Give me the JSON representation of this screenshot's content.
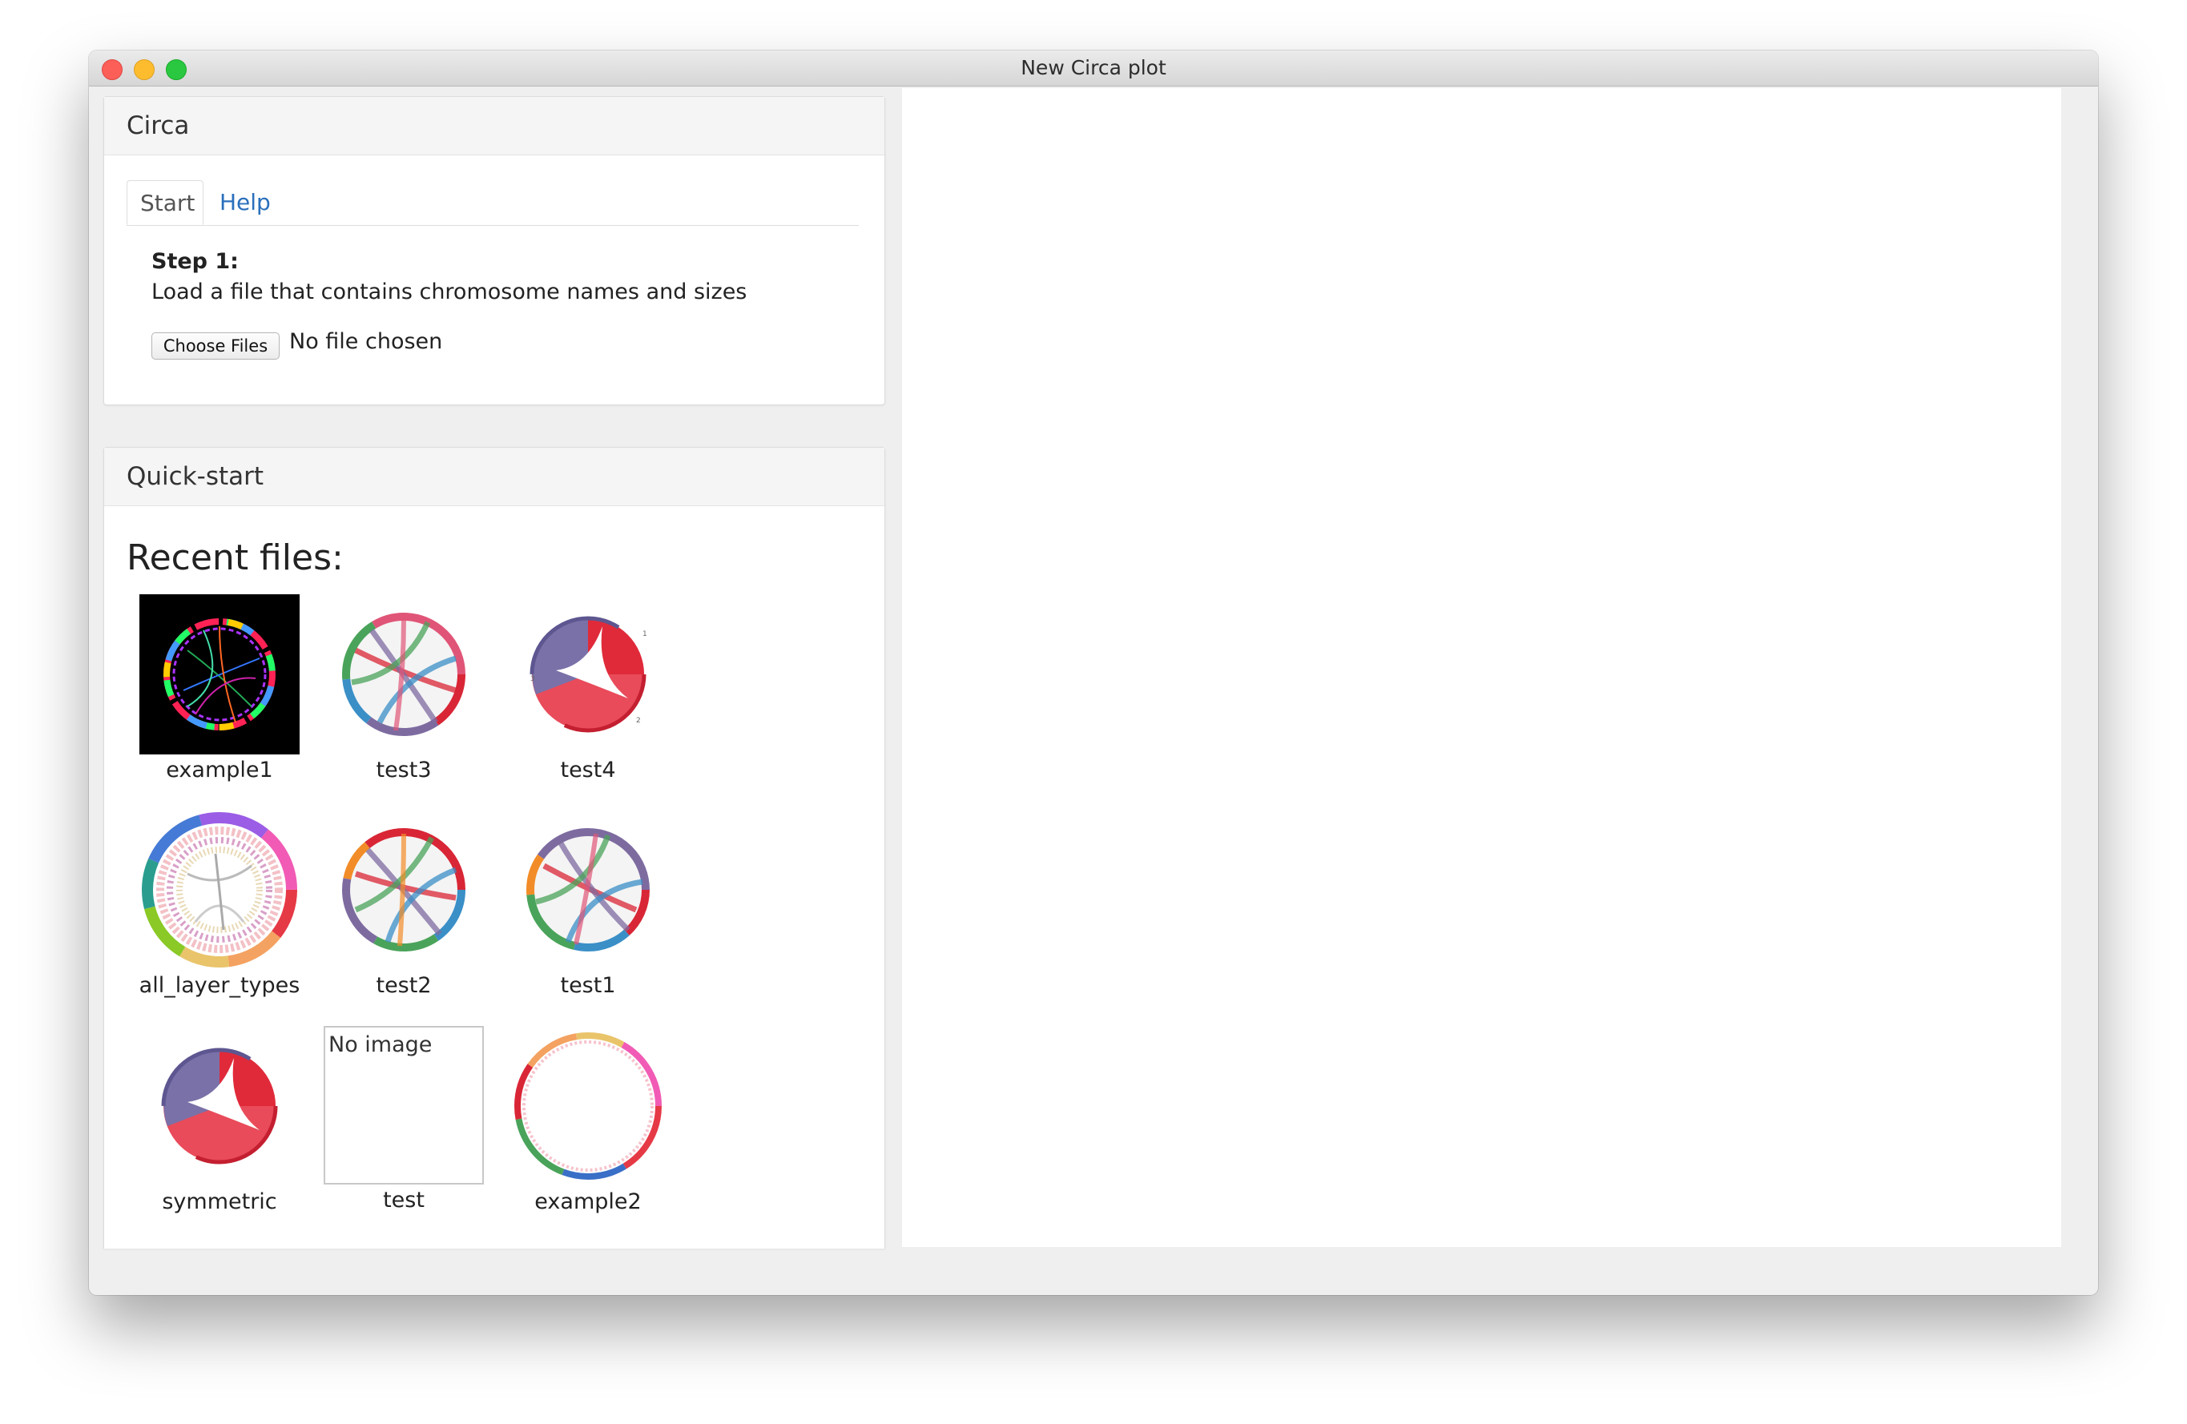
{
  "window": {
    "title": "New Circa plot"
  },
  "circa_panel": {
    "title": "Circa",
    "tabs": [
      {
        "label": "Start",
        "active": true
      },
      {
        "label": "Help",
        "active": false
      }
    ],
    "step_title": "Step 1:",
    "step_description": "Load a file that contains chromosome names and sizes",
    "file_button": "Choose Files",
    "file_status": "No file chosen"
  },
  "quickstart_panel": {
    "title": "Quick-start",
    "recent_heading": "Recent files:",
    "files": [
      {
        "name": "example1",
        "thumbnail": "dark-rainbow-circos-thumb"
      },
      {
        "name": "test3",
        "thumbnail": "chord-thumb"
      },
      {
        "name": "test4",
        "thumbnail": "red-purple-chord-thumb"
      },
      {
        "name": "all_layer_types",
        "thumbnail": "multilayer-rainbow-thumb"
      },
      {
        "name": "test2",
        "thumbnail": "chord-thumb"
      },
      {
        "name": "test1",
        "thumbnail": "chord-thumb"
      },
      {
        "name": "symmetric",
        "thumbnail": "red-purple-chord-thumb"
      },
      {
        "name": "test",
        "thumbnail": "none",
        "placeholder": "No image"
      },
      {
        "name": "example2",
        "thumbnail": "rainbow-ring-thumb"
      }
    ]
  },
  "colors": {
    "link": "#2a6fbb",
    "close": "#fc5f57",
    "minimize": "#fdbc2e",
    "maximize": "#29c840"
  }
}
